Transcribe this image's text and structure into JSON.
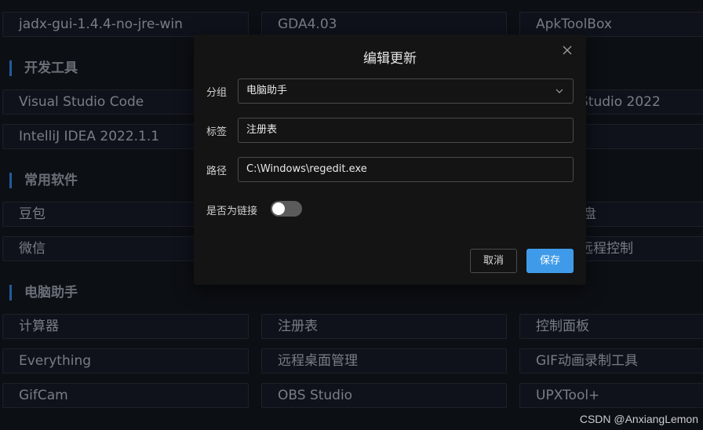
{
  "top_row": [
    "jadx-gui-1.4.4-no-jre-win",
    "GDA4.03",
    "ApkToolBox"
  ],
  "sections": {
    "dev": {
      "title": "开发工具",
      "tiles": [
        "Visual Studio Code",
        "IntelliJ IDEA 2022.1.1",
        "Studio 2022"
      ]
    },
    "common": {
      "title": "常用软件",
      "tiles": [
        "豆包",
        "微信",
        "盘",
        "远程控制"
      ]
    },
    "helper": {
      "title": "电脑助手",
      "tiles": [
        "计算器",
        "注册表",
        "控制面板",
        "Everything",
        "远程桌面管理",
        "GIF动画录制工具",
        "GifCam",
        "OBS Studio",
        "UPXTool+"
      ]
    }
  },
  "modal": {
    "title": "编辑更新",
    "group_label": "分组",
    "group_value": "电脑助手",
    "tag_label": "标签",
    "tag_value": "注册表",
    "path_label": "路径",
    "path_value": "C:\\Windows\\regedit.exe",
    "link_label": "是否为链接",
    "is_link": false,
    "cancel_label": "取消",
    "save_label": "保存",
    "close_icon": "close-icon"
  },
  "watermark": "CSDN @AnxiangLemon",
  "colors": {
    "accent": "#3f9bea",
    "section_bar": "#2a6bb8",
    "background": "#0f1218"
  }
}
